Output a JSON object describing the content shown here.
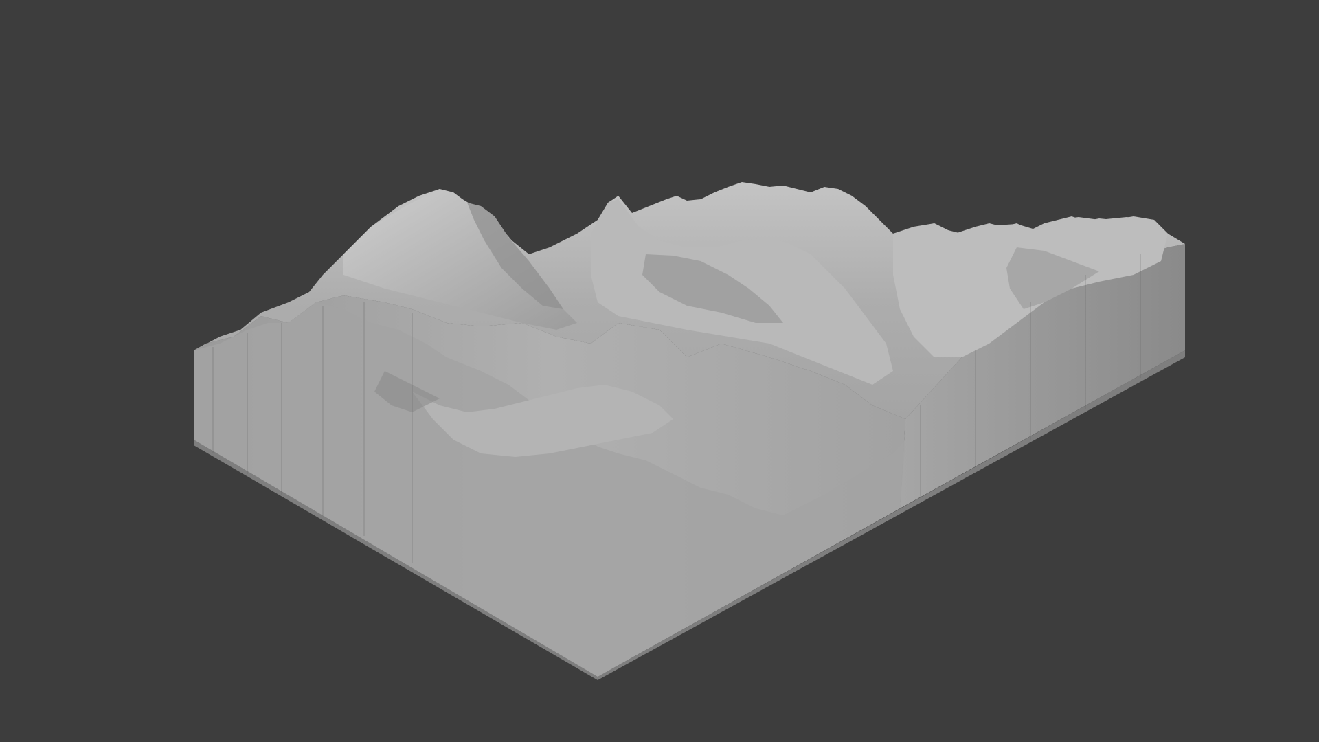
{
  "scene": {
    "background_color": "#3d3d3d",
    "object": "terrain-block",
    "material_color": "#a9a9a9",
    "description_visible_text": ""
  }
}
